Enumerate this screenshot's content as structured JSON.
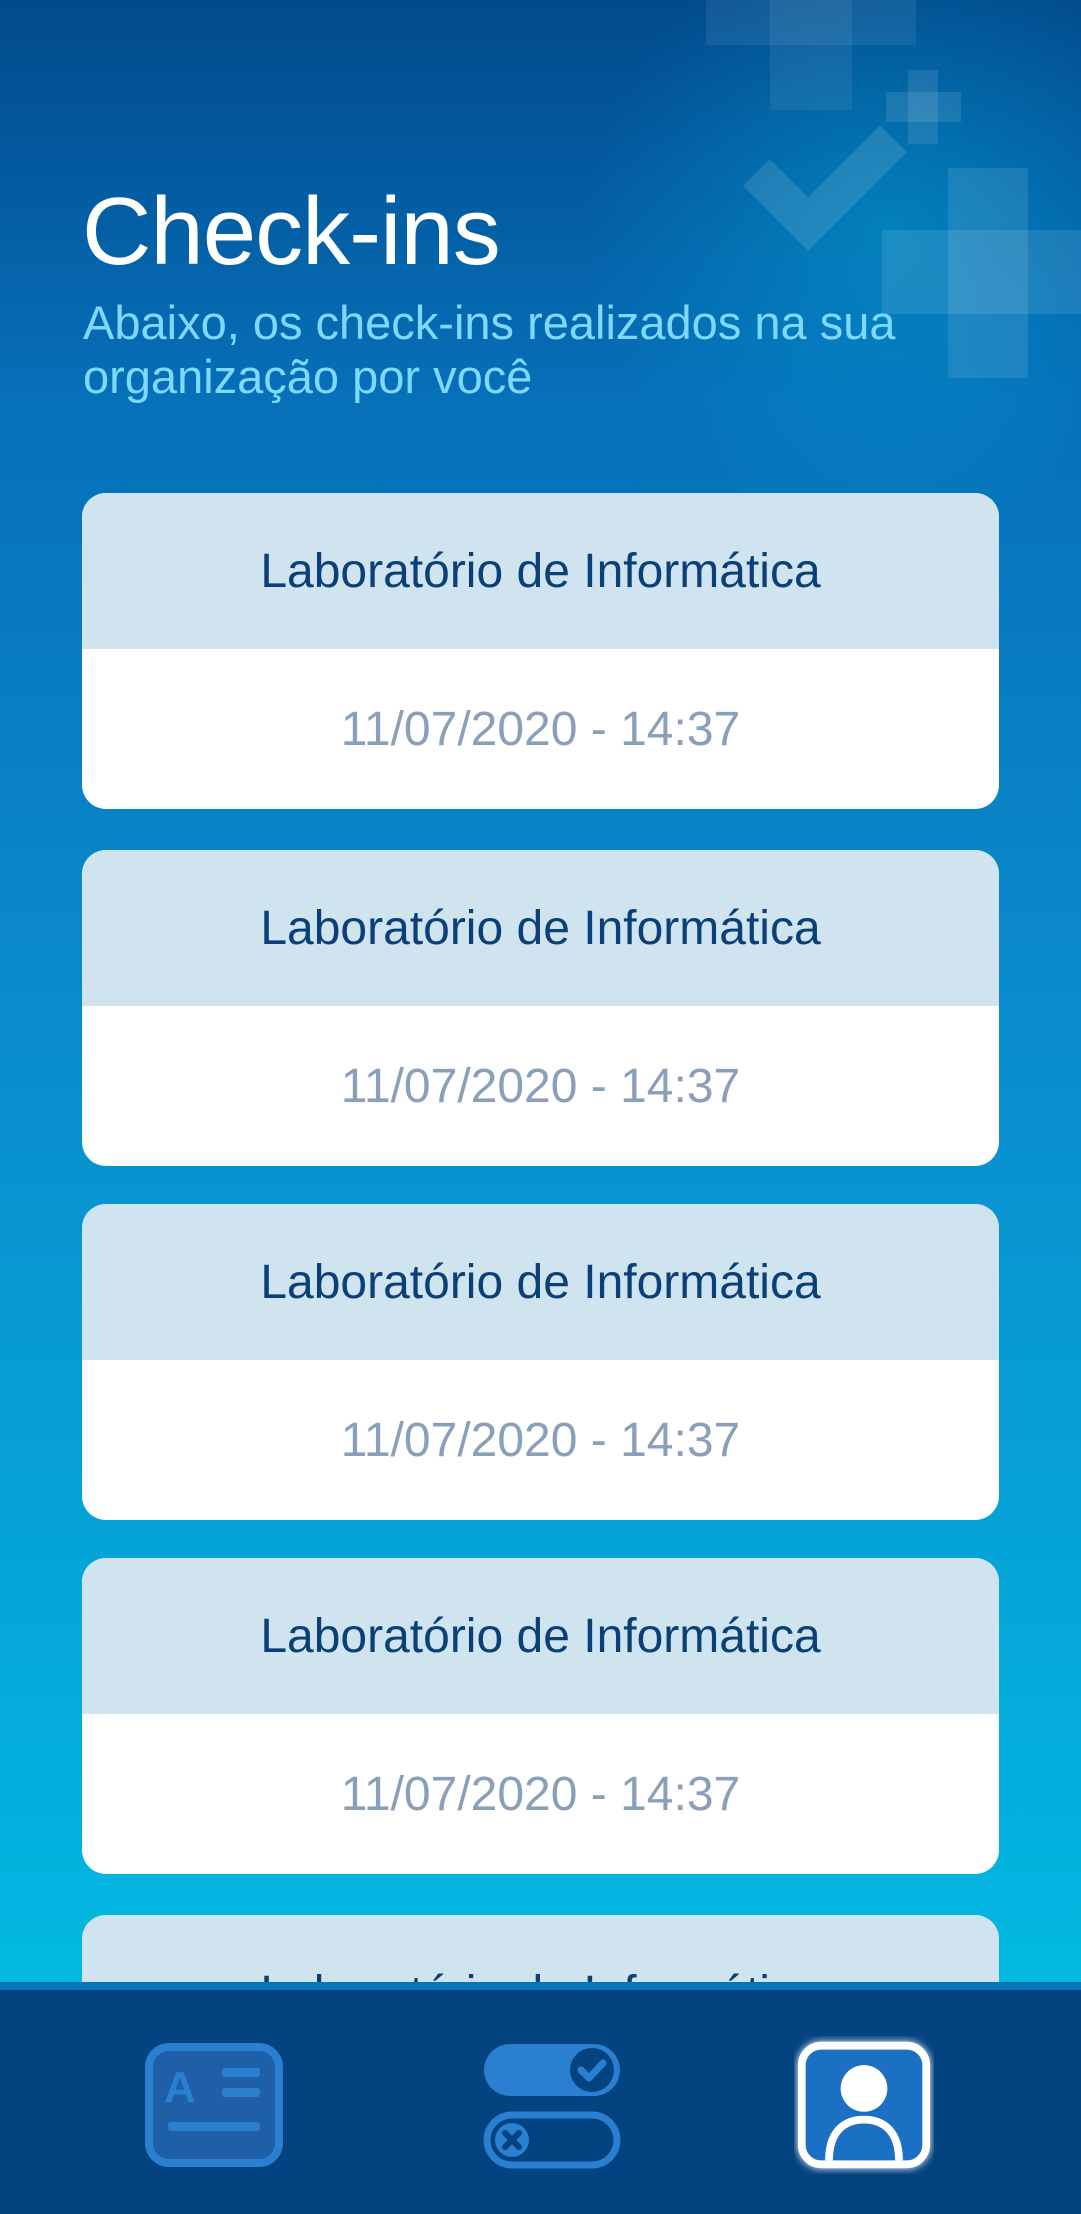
{
  "header": {
    "title": "Check-ins",
    "subtitle": "Abaixo, os check-ins realizados na sua organização por você"
  },
  "checkins": [
    {
      "place": "Laboratório de Informática",
      "datetime": "11/07/2020 - 14:37"
    },
    {
      "place": "Laboratório de Informática",
      "datetime": "11/07/2020 - 14:37"
    },
    {
      "place": "Laboratório de Informática",
      "datetime": "11/07/2020 - 14:37"
    },
    {
      "place": "Laboratório de Informática",
      "datetime": "11/07/2020 - 14:37"
    },
    {
      "place": "Laboratório de Informática",
      "datetime": ""
    }
  ],
  "bottom_nav": {
    "items": [
      {
        "icon": "id-card-icon",
        "active": false
      },
      {
        "icon": "toggle-checkin-icon",
        "active": false
      },
      {
        "icon": "profile-icon",
        "active": true
      }
    ]
  },
  "colors": {
    "background_top": "#024a8c",
    "background_bottom": "#00c4e6",
    "subtitle": "#7fd8ff",
    "card_header": "#cfe4ee",
    "card_title": "#0a3f78",
    "card_date": "#8aa0b8",
    "nav_bg": "#03437f",
    "nav_icon": "#2a7fd0",
    "nav_active": "#ffffff"
  }
}
